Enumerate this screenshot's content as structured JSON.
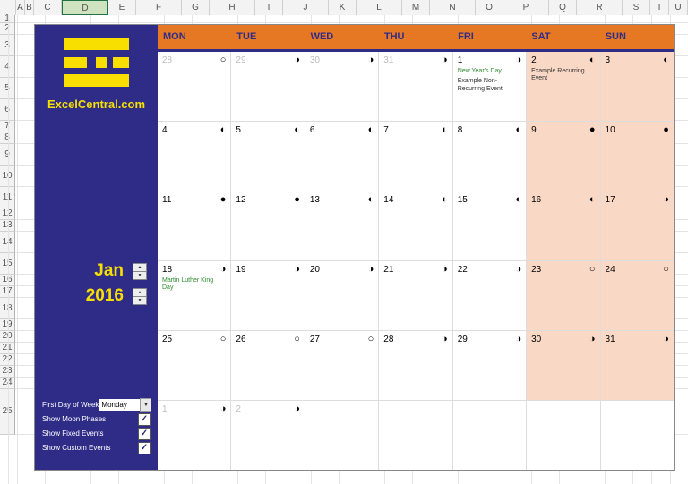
{
  "columns": [
    "A",
    "B",
    "C",
    "D",
    "E",
    "F",
    "G",
    "H",
    "I",
    "J",
    "K",
    "L",
    "M",
    "N",
    "O",
    "P",
    "Q",
    "R",
    "S",
    "T",
    "U"
  ],
  "selected_col": "D",
  "rows": [
    "1",
    "2",
    "3",
    "4",
    "5",
    "6",
    "7",
    "8",
    "9",
    "10",
    "11",
    "12",
    "13",
    "14",
    "15",
    "16",
    "17",
    "18",
    "19",
    "20",
    "21",
    "22",
    "23",
    "24",
    "25"
  ],
  "brand": "ExcelCentral.com",
  "month_label": "Jan",
  "year_label": "2016",
  "options": {
    "first_day_label": "First Day of Week",
    "first_day_value": "Monday",
    "moon_label": "Show Moon Phases",
    "fixed_label": "Show Fixed Events",
    "custom_label": "Show Custom Events"
  },
  "day_headers": [
    "MON",
    "TUE",
    "WED",
    "THU",
    "FRI",
    "SAT",
    "SUN"
  ],
  "weeks": [
    [
      {
        "n": "28",
        "gray": true,
        "moon": "○"
      },
      {
        "n": "29",
        "gray": true,
        "moon": "◑"
      },
      {
        "n": "30",
        "gray": true,
        "moon": "◑"
      },
      {
        "n": "31",
        "gray": true,
        "moon": "◑"
      },
      {
        "n": "1",
        "moon": "◑",
        "events": [
          {
            "t": "New Year's Day",
            "k": "holiday"
          },
          {
            "t": "Example Non-Recurring Event",
            "k": "custom"
          }
        ]
      },
      {
        "n": "2",
        "moon": "◐",
        "weekend": true,
        "events": [
          {
            "t": "Example Recurring Event",
            "k": "custom"
          }
        ]
      },
      {
        "n": "3",
        "moon": "◐",
        "weekend": true
      }
    ],
    [
      {
        "n": "4",
        "moon": "◐"
      },
      {
        "n": "5",
        "moon": "◐"
      },
      {
        "n": "6",
        "moon": "◐"
      },
      {
        "n": "7",
        "moon": "◐"
      },
      {
        "n": "8",
        "moon": "◐"
      },
      {
        "n": "9",
        "moon": "●",
        "weekend": true
      },
      {
        "n": "10",
        "moon": "●",
        "weekend": true
      }
    ],
    [
      {
        "n": "11",
        "moon": "●"
      },
      {
        "n": "12",
        "moon": "●"
      },
      {
        "n": "13",
        "moon": "◐"
      },
      {
        "n": "14",
        "moon": "◐"
      },
      {
        "n": "15",
        "moon": "◐"
      },
      {
        "n": "16",
        "moon": "◐",
        "weekend": true
      },
      {
        "n": "17",
        "moon": "◑",
        "weekend": true
      }
    ],
    [
      {
        "n": "18",
        "moon": "◑",
        "events": [
          {
            "t": "Martin Luther King Day",
            "k": "holiday"
          }
        ]
      },
      {
        "n": "19",
        "moon": "◑"
      },
      {
        "n": "20",
        "moon": "◑"
      },
      {
        "n": "21",
        "moon": "◑"
      },
      {
        "n": "22",
        "moon": "◑"
      },
      {
        "n": "23",
        "moon": "○",
        "weekend": true
      },
      {
        "n": "24",
        "moon": "○",
        "weekend": true
      }
    ],
    [
      {
        "n": "25",
        "moon": "○"
      },
      {
        "n": "26",
        "moon": "○"
      },
      {
        "n": "27",
        "moon": "○"
      },
      {
        "n": "28",
        "moon": "◑"
      },
      {
        "n": "29",
        "moon": "◑"
      },
      {
        "n": "30",
        "moon": "◑",
        "weekend": true
      },
      {
        "n": "31",
        "moon": "◑",
        "weekend": true
      }
    ],
    [
      {
        "n": "1",
        "gray": true,
        "moon": "◑"
      },
      {
        "n": "2",
        "gray": true,
        "moon": "◑"
      },
      {
        "n": "",
        "blank": true
      },
      {
        "n": "",
        "blank": true
      },
      {
        "n": "",
        "blank": true
      },
      {
        "n": "",
        "blank": true,
        "weekend": false
      },
      {
        "n": "",
        "blank": true,
        "weekend": false
      }
    ]
  ]
}
